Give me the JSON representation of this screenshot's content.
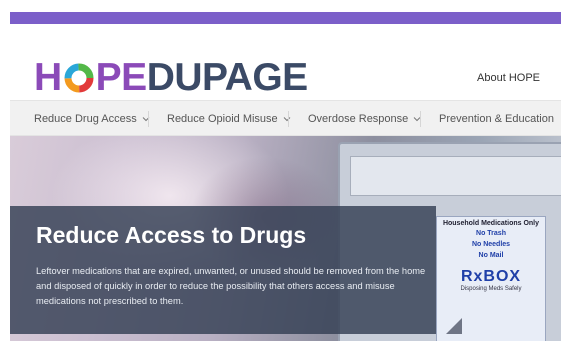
{
  "header": {
    "logo_hope": "H",
    "logo_hope2": "PE",
    "logo_dupage": "DUPAGE",
    "about_link": "About HOPE"
  },
  "nav": {
    "items": [
      {
        "label": "Reduce Drug Access",
        "has_dropdown": true
      },
      {
        "label": "Reduce Opioid Misuse",
        "has_dropdown": true
      },
      {
        "label": "Overdose Response",
        "has_dropdown": true
      },
      {
        "label": "Prevention & Education",
        "has_dropdown": false
      }
    ]
  },
  "hero": {
    "title": "Reduce Access to Drugs",
    "body": "Leftover medications that are expired, unwanted, or unused should be removed from the home and disposed of quickly in order to reduce the possibility that others access and misuse medications not prescribed to them.",
    "sign": {
      "heading": "Household Medications Only",
      "lines": [
        "No Trash",
        "No Needles",
        "No Mail"
      ],
      "brand": "RxBOX",
      "tagline": "Disposing Meds Safely"
    }
  },
  "colors": {
    "top_band": "#7b5fc9",
    "logo_purple": "#8b4ab8",
    "logo_navy": "#3b4a66",
    "overlay": "#344054"
  }
}
